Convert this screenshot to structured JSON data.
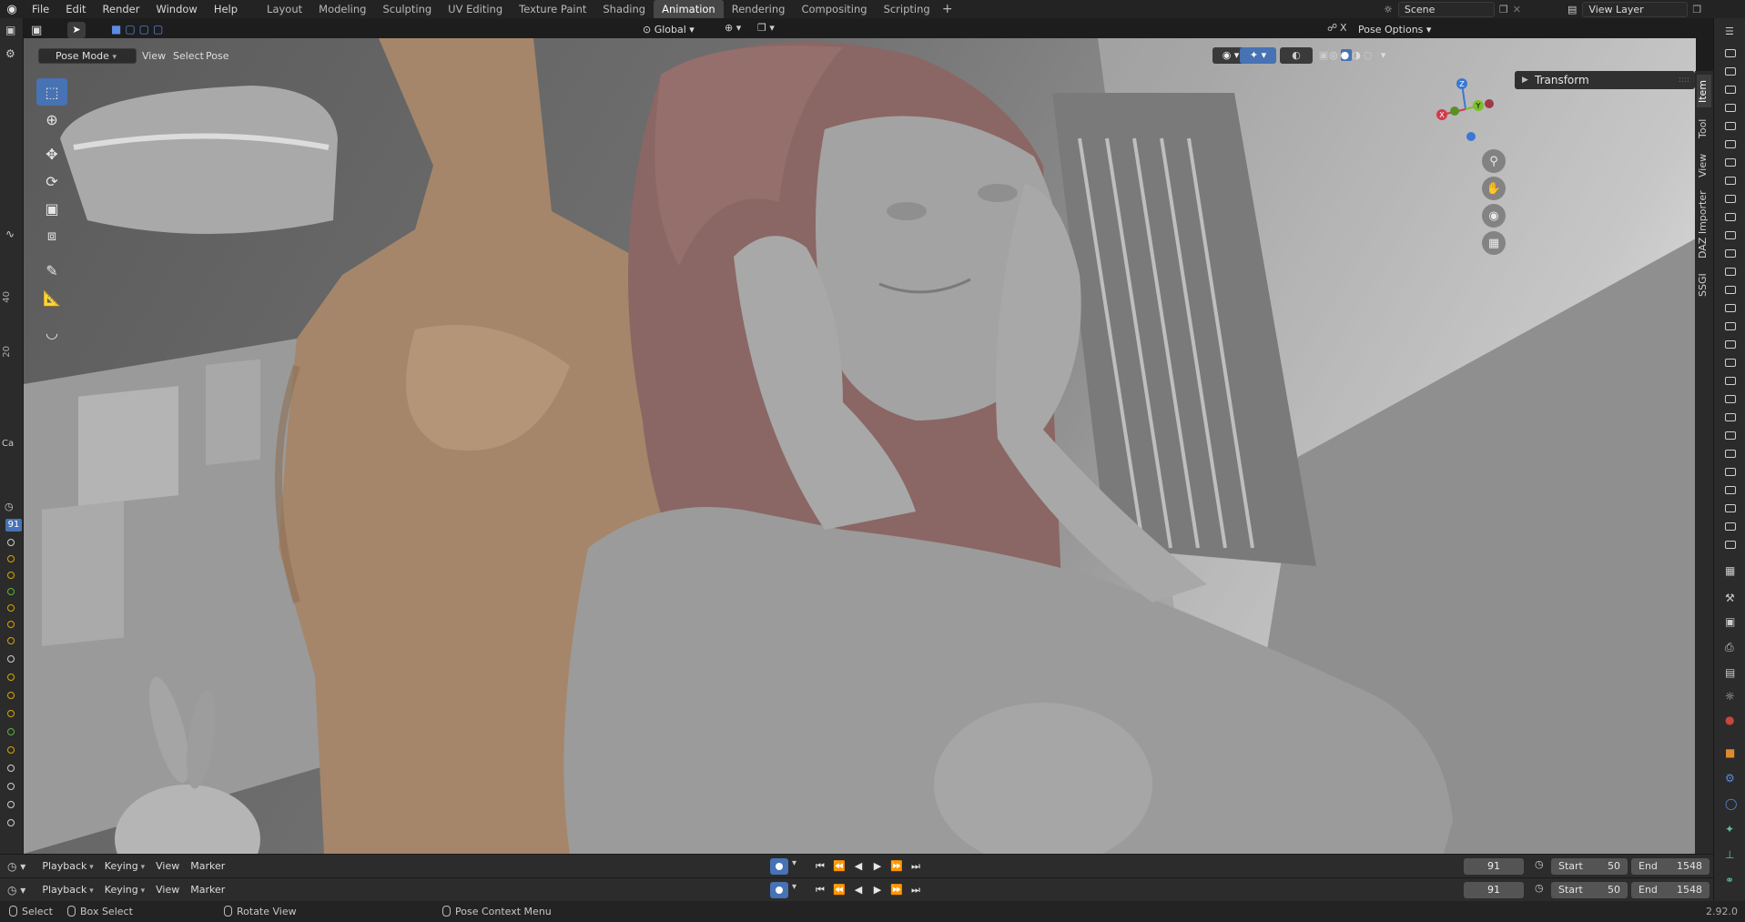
{
  "menu": {
    "items": [
      "File",
      "Edit",
      "Render",
      "Window",
      "Help"
    ]
  },
  "workspaces": {
    "tabs": [
      "Layout",
      "Modeling",
      "Sculpting",
      "UV Editing",
      "Texture Paint",
      "Shading",
      "Animation",
      "Rendering",
      "Compositing",
      "Scripting"
    ],
    "active": "Animation"
  },
  "scene": {
    "name": "Scene",
    "view_layer": "View Layer"
  },
  "viewport_header": {
    "orientation": "Global",
    "pose_options": "Pose Options",
    "mode": "Pose Mode",
    "menus": [
      "View",
      "Select",
      "Pose"
    ]
  },
  "npanel": {
    "section": "Transform",
    "tabs": [
      "Item",
      "Tool",
      "View",
      "DAZ Importer",
      "SSGI"
    ],
    "active_tab": "Item"
  },
  "left_strip": {
    "ruler_labels": [
      "40",
      "20"
    ],
    "frame_badge": "91",
    "ca_label": "Ca"
  },
  "timeline": {
    "menus": [
      "Playback",
      "Keying",
      "View",
      "Marker"
    ],
    "current_frame": "91",
    "start_label": "Start",
    "start": "50",
    "end_label": "End",
    "end": "1548"
  },
  "statusbar": {
    "select": "Select",
    "box_select": "Box Select",
    "rotate_view": "Rotate View",
    "context_menu": "Pose Context Menu",
    "version": "2.92.0"
  },
  "colors": {
    "accent": "#4772b3",
    "hair": "#8a6764",
    "skin_male": "#a5866a",
    "skin_female": "#9b9b9b",
    "keyframe": "#d7a600"
  }
}
